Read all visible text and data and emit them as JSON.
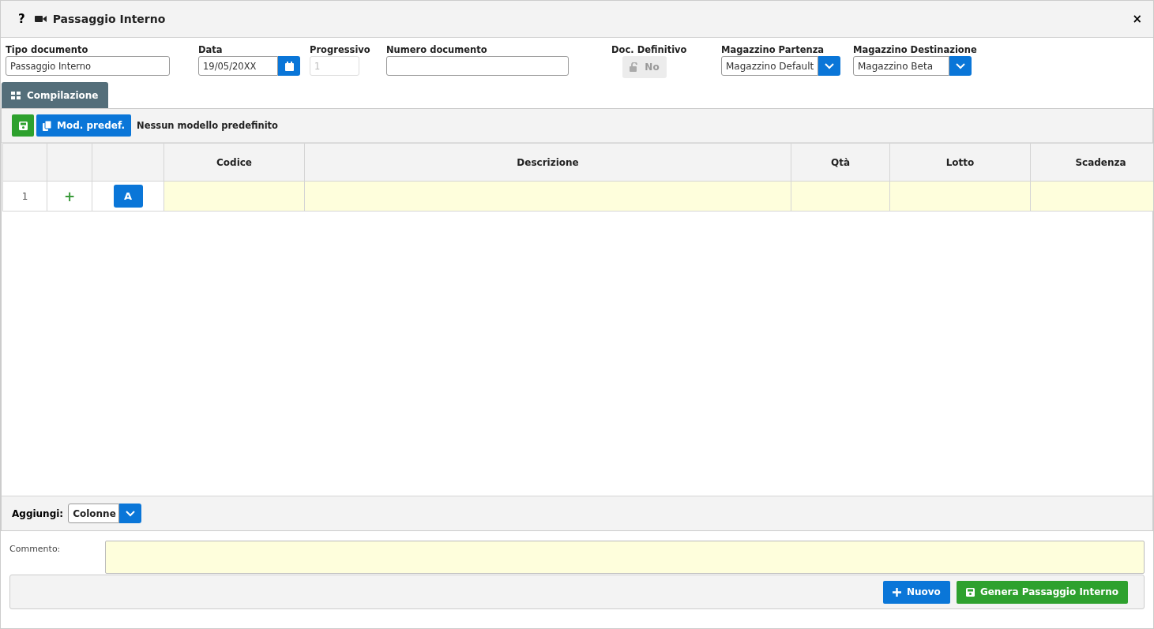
{
  "window": {
    "help": "?",
    "title": "Passaggio Interno",
    "close": "×"
  },
  "fields": [
    {
      "kind": "text",
      "label": "Tipo documento",
      "value": "Passaggio Interno",
      "disabled": false
    },
    {
      "kind": "date",
      "label": "Data",
      "value": "19/05/20XX",
      "disabled": false
    },
    {
      "kind": "text",
      "label": "Progressivo",
      "value": "1",
      "disabled": true
    },
    {
      "kind": "text",
      "label": "Numero documento",
      "disabled": false
    },
    {
      "kind": "toggle",
      "label": "Doc. Definitivo",
      "value": "No",
      "disabled": true
    },
    {
      "kind": "select",
      "label": "Magazzino Partenza",
      "value": "Magazzino Default",
      "disabled": false
    },
    {
      "kind": "select",
      "label": "Magazzino Destinazione",
      "value": "Magazzino Beta",
      "disabled": false
    }
  ],
  "tabs": [
    {
      "label": "Compilazione",
      "selected": true
    }
  ],
  "toolbar": {
    "model_button": "Mod. predef.",
    "model_status": "Nessun modello predefinito"
  },
  "table": {
    "columns": [
      "",
      "",
      "",
      "Codice",
      "Descrizione",
      "Qtà",
      "Lotto",
      "Scadenza"
    ],
    "rows": [
      {
        "number": "1",
        "add": "+",
        "action": "A"
      }
    ]
  },
  "add_bar": {
    "label": "Aggiungi:",
    "value": "Colonne"
  },
  "comment": {
    "label": "Commento:"
  },
  "buttons": [
    {
      "kind": "new",
      "label": "Nuovo"
    },
    {
      "kind": "save",
      "label": "Genera Passaggio Interno"
    }
  ]
}
